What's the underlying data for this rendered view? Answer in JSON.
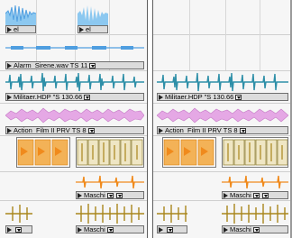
{
  "colors": {
    "blue": "#4f9ee0",
    "teal": "#2e8fa8",
    "pink": "#d98ad9",
    "orange": "#f08a1c",
    "olive": "#a9861c",
    "lightblue": "#8cc8f0"
  },
  "left_pane": {
    "top_clip_label_1": "el",
    "top_clip_label_2": "el",
    "track_alarm_label": "Alarm_Sirene.wav TS 11",
    "track_militaer_label": "Militaer.HDP \"S 130.66",
    "track_action_label": "Action_Film II PRV TS 8",
    "track_maschi_label_1": "Maschi",
    "track_maschi_label_2": "Maschi"
  },
  "right_pane": {
    "track_militaer_label": "Militaer.HDP \"S 130.66",
    "track_action_label": "Action_Film II PRV TS 8",
    "track_maschi_label_1": "Maschi",
    "track_maschi_label_2": "Maschi"
  },
  "icons": {
    "play_marker": "play-arrow-icon",
    "dropdown": "dropdown-arrow-icon"
  }
}
